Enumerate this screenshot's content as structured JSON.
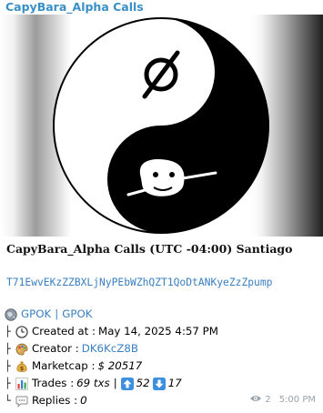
{
  "message": {
    "sender": "CapyBara_Alpha Calls",
    "title": "CapyBara_Alpha Calls (UTC -04:00) Santiago",
    "address": "T71EwvEKzZZBXLjNyPEbWZhQZT1QoDtANKyeZzZpump",
    "token": {
      "symbol": "GPOK",
      "separator": "|",
      "name": "GPOK"
    },
    "created": {
      "label": "Created at : ",
      "value": "May 14, 2025 4:57 PM"
    },
    "creator": {
      "label": "Creator : ",
      "value": "DK6KcZ8B"
    },
    "marketcap": {
      "label": "Marketcap : ",
      "value": "$ 20517"
    },
    "trades": {
      "label": "Trades : ",
      "txs": "69 txs",
      "separator": "|",
      "buys": "52",
      "sells": "17"
    },
    "replies": {
      "label": "Replies : ",
      "value": "0"
    },
    "views": "2",
    "time": "5:00 PM"
  },
  "icons": [
    "globe-icon",
    "clock-icon",
    "palette-icon",
    "money-bag-icon",
    "bar-chart-icon",
    "up-arrow-icon",
    "down-arrow-icon",
    "speech-bubble-icon",
    "eye-icon"
  ],
  "colors": {
    "sender": "#3a8fc7",
    "link": "#3a7fbf",
    "meta": "#9aa3ab",
    "arrow_button": "#3d8fe0"
  }
}
